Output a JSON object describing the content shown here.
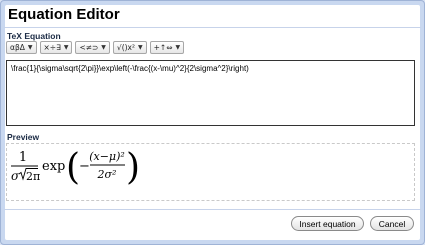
{
  "dialog": {
    "title": "Equation Editor"
  },
  "tex_section": {
    "label": "TeX Equation"
  },
  "toolbar": {
    "menus": [
      {
        "label": "αβΔ",
        "icon": "greek-letters-icon"
      },
      {
        "label": "×÷∃",
        "icon": "operators-icon"
      },
      {
        "label": "<≠⊃",
        "icon": "relations-icon"
      },
      {
        "label": "√()x²",
        "icon": "math-structures-icon"
      },
      {
        "label": "+↑⇔",
        "icon": "arrows-icon"
      }
    ]
  },
  "editor": {
    "value": "\\frac{1}{\\sigma\\sqrt{2\\pi}}\\exp\\left(-\\frac{(x-\\mu)^2}{2\\sigma^2}\\right)"
  },
  "preview_section": {
    "label": "Preview"
  },
  "preview": {
    "num1": "1",
    "den1_sigma": "σ",
    "den1_rad": "2π",
    "exp": "exp",
    "num2": "(x−μ)²",
    "den2": "2σ²",
    "minus": "−",
    "lparen": "(",
    "rparen": ")"
  },
  "buttons": {
    "insert": "Insert equation",
    "cancel": "Cancel"
  }
}
